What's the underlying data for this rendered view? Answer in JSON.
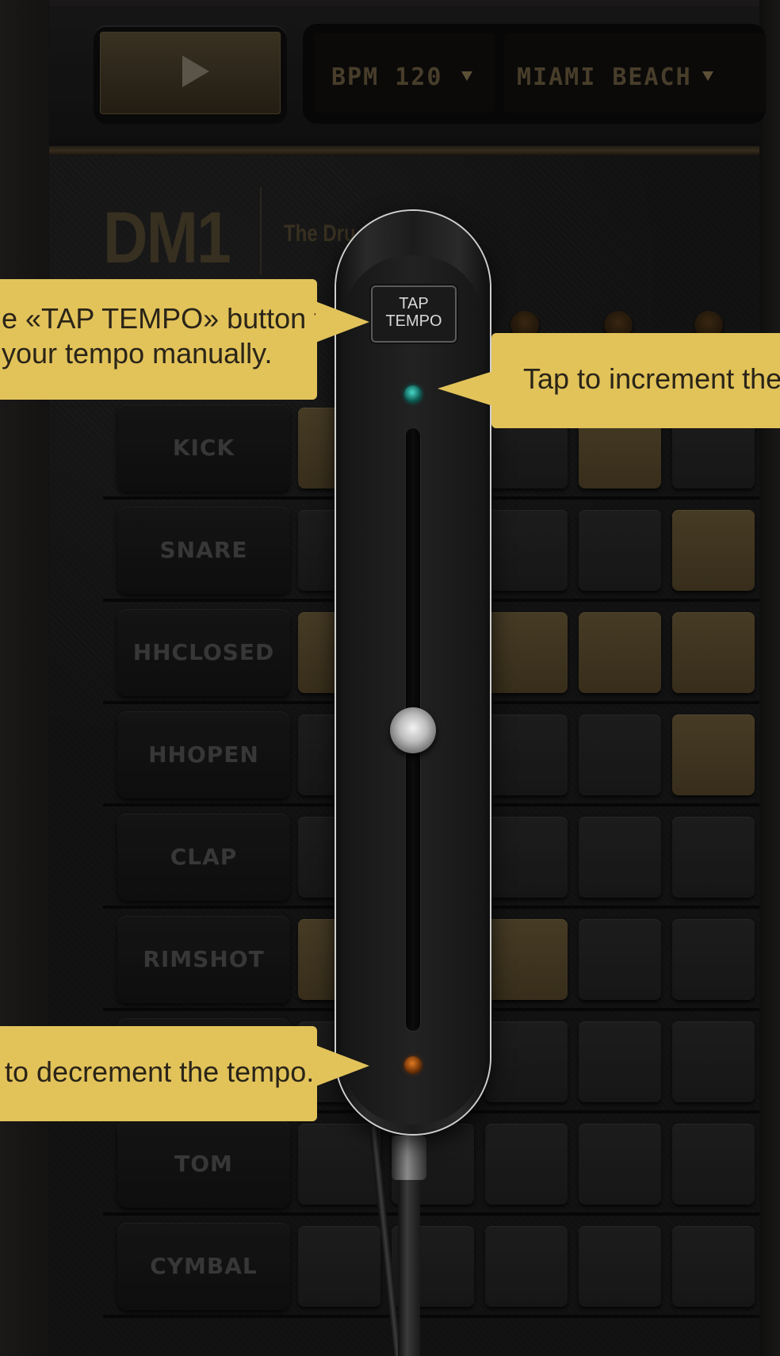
{
  "transport": {
    "play_icon": "play-icon",
    "bpm_display": "BPM 120",
    "pattern_display": "MIAMI BEACH",
    "dropdown_icon": "chevron-down-icon"
  },
  "brand": {
    "logo": "DM1",
    "subtitle": "The Dru"
  },
  "instruments": [
    {
      "label": "KICK",
      "pads": [
        true,
        false,
        false,
        true,
        false
      ]
    },
    {
      "label": "SNARE",
      "pads": [
        false,
        false,
        false,
        false,
        true
      ]
    },
    {
      "label": "HHCLOSED",
      "pads": [
        true,
        false,
        true,
        true,
        true
      ]
    },
    {
      "label": "HHOPEN",
      "pads": [
        false,
        false,
        false,
        false,
        true
      ]
    },
    {
      "label": "CLAP",
      "pads": [
        false,
        false,
        false,
        false,
        false
      ]
    },
    {
      "label": "RIMSHOT",
      "pads": [
        true,
        false,
        true,
        false,
        false
      ]
    },
    {
      "label": "",
      "pads": [
        false,
        false,
        false,
        false,
        false
      ]
    },
    {
      "label": "TOM",
      "pads": [
        false,
        false,
        false,
        false,
        false
      ]
    },
    {
      "label": "CYMBAL",
      "pads": [
        false,
        false,
        false,
        false,
        false
      ]
    }
  ],
  "tap_tempo": {
    "line1": "TAP",
    "line2": "TEMPO"
  },
  "tooltips": {
    "tap_line1": "e «TAP TEMPO» button to",
    "tap_line2": "your tempo manually.",
    "increment": "Tap to increment the te",
    "decrement": "to decrement the tempo."
  },
  "colors": {
    "tooltip": "#e2c35a",
    "pad_on": "#4a3d24",
    "led_up": "#2fb8a8",
    "led_down": "#c0621a"
  }
}
